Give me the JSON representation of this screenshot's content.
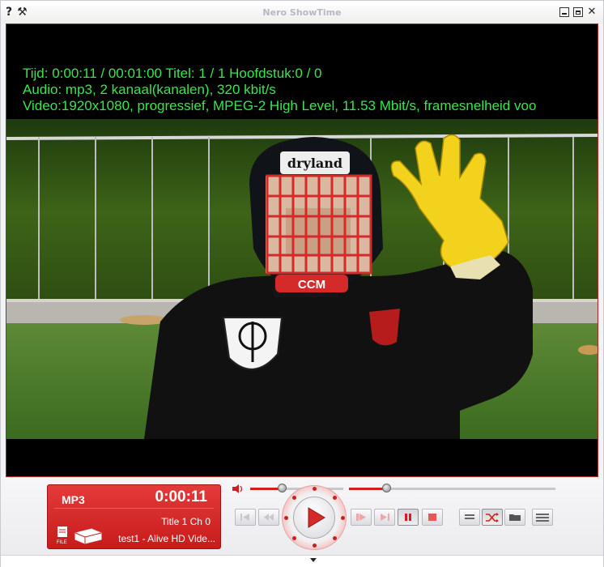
{
  "window": {
    "title": "Nero ShowTime",
    "help_glyph": "?",
    "tools_glyph": "⚒",
    "close_glyph": "✕"
  },
  "osd": {
    "line1": "Tijd: 0:00:11 / 00:01:00 Titel: 1 / 1 Hoofdstuk:0 / 0",
    "line2": "Audio: mp3, 2 kanaal(kanalen), 320 kbit/s",
    "line3": "Video:1920x1080, progressief, MPEG-2 High Level, 11.53 Mbit/s, framesnelheid voo",
    "color": "#35e84a"
  },
  "video_frame": {
    "helmet_brand": "dryland",
    "helmet_chin": "CCM"
  },
  "lcd": {
    "format": "MP3",
    "time": "0:00:11",
    "title_chapter": "Title  1    Ch 0",
    "filename": "test1 - Alive HD Vide...",
    "file_label": "FILE",
    "color": "#d42a2a"
  },
  "controls": {
    "volume_level": 0.34,
    "seek_position": 0.18,
    "accent": "#d21e1e"
  }
}
